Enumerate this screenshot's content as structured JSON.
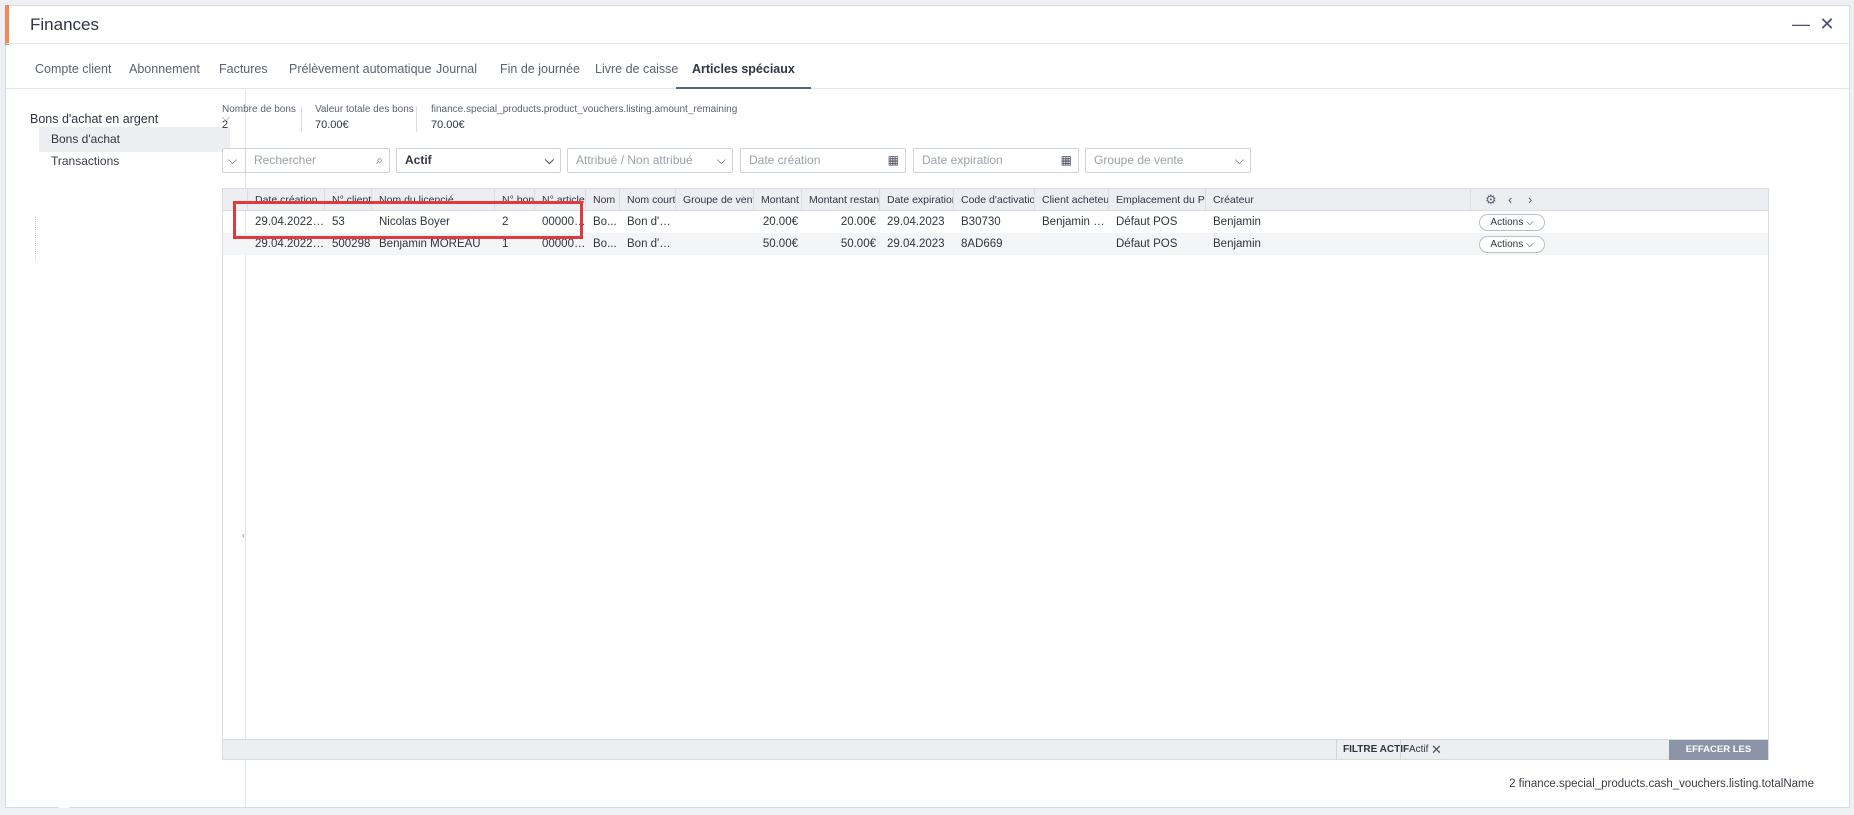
{
  "window": {
    "title": "Finances"
  },
  "tabs": [
    {
      "label": "Compte client"
    },
    {
      "label": "Abonnement"
    },
    {
      "label": "Factures"
    },
    {
      "label": "Prélèvement automatique"
    },
    {
      "label": "Journal"
    },
    {
      "label": "Fin de journée"
    },
    {
      "label": "Livre de caisse"
    },
    {
      "label": "Articles spéciaux"
    }
  ],
  "sidebar": {
    "group_label": "Bons d'achat en argent",
    "items": [
      {
        "label": "Bons d'achat"
      },
      {
        "label": "Transactions"
      }
    ]
  },
  "kpis": [
    {
      "label": "Nombre de bons",
      "value": "2"
    },
    {
      "label": "Valeur totale des bons",
      "value": "70.00€"
    },
    {
      "label": "finance.special_products.product_vouchers.listing.amount_remaining",
      "value": "70.00€"
    }
  ],
  "filters": {
    "search_placeholder": "Rechercher",
    "status_value": "Actif",
    "assigned_placeholder": "Attribué / Non attribué",
    "date_creation_placeholder": "Date création",
    "date_expiration_placeholder": "Date expiration",
    "sales_group_placeholder": "Groupe de vente"
  },
  "table": {
    "columns": [
      "Date création",
      "N° client",
      "Nom du licencié",
      "N° bon",
      "N° article",
      "Nom",
      "Nom court",
      "Groupe de vente",
      "Montant",
      "Montant restant",
      "Date expiration",
      "Code d'activation",
      "Client acheteur",
      "Emplacement du POS",
      "Créateur"
    ],
    "rows": [
      [
        "29.04.2022 15:...",
        "53",
        "Nicolas Boyer",
        "2",
        "000000...",
        "Bo...",
        "Bon d'ac...",
        "",
        "20.00€",
        "20.00€",
        "29.04.2023",
        "B30730",
        "Benjamin M...",
        "Défaut POS",
        "Benjamin"
      ],
      [
        "29.04.2022 14:...",
        "500298",
        "Benjamin MOREAU",
        "1",
        "000000...",
        "Bo...",
        "Bon d'ac...",
        "",
        "50.00€",
        "50.00€",
        "29.04.2023",
        "8AD669",
        "",
        "Défaut POS",
        "Benjamin"
      ]
    ],
    "actions_label": "Actions"
  },
  "footer": {
    "active_filter_label": "FILTRE ACTIF",
    "active_filter_value": "Actif",
    "clear_filters_label": "EFFACER LES FILTRES"
  },
  "total_text": "2 finance.special_products.cash_vouchers.listing.totalName",
  "colors": {
    "accent": "#f08a5d",
    "highlight": "#e0393e",
    "clear_button": "#8b94a6"
  }
}
